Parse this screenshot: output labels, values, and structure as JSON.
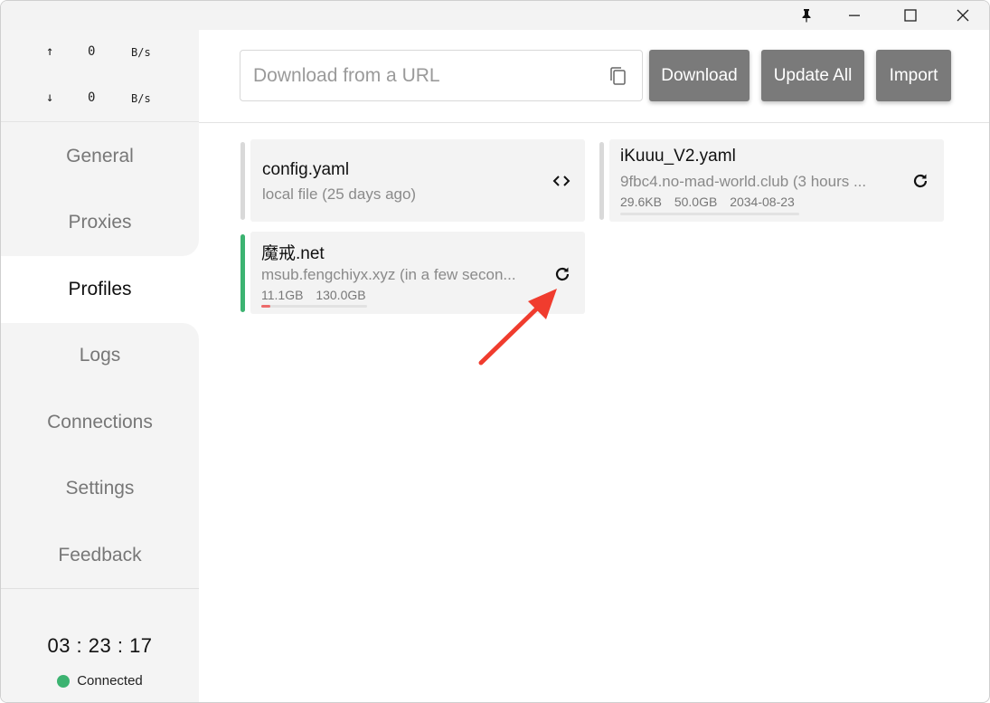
{
  "titlebar": {
    "pin_icon": "pin-icon",
    "minimize_icon": "minimize-icon",
    "maximize_icon": "maximize-icon",
    "close_icon": "close-icon"
  },
  "traffic": {
    "upload": {
      "arrow": "↑",
      "value": "0",
      "unit": "B/s"
    },
    "download": {
      "arrow": "↓",
      "value": "0",
      "unit": "B/s"
    }
  },
  "nav": {
    "items": [
      {
        "label": "General"
      },
      {
        "label": "Proxies"
      },
      {
        "label": "Profiles"
      },
      {
        "label": "Logs"
      },
      {
        "label": "Connections"
      },
      {
        "label": "Settings"
      },
      {
        "label": "Feedback"
      }
    ],
    "active": "Profiles"
  },
  "status": {
    "clock": "03 : 23 : 17",
    "connection": "Connected",
    "connection_color": "#3cb371"
  },
  "header": {
    "url_placeholder": "Download from a URL",
    "url_value": "",
    "download_label": "Download",
    "update_all_label": "Update All",
    "import_label": "Import"
  },
  "profiles": [
    {
      "name": "config.yaml",
      "subtitle": "local file (25 days ago)",
      "action_icon": "code-icon",
      "selected": false
    },
    {
      "name": "iKuuu_V2.yaml",
      "subtitle": "9fbc4.no-mad-world.club (3 hours ...",
      "used": "29.6KB",
      "total": "50.0GB",
      "expires": "2034-08-23",
      "usage_fraction": 0.0,
      "action_icon": "refresh-icon",
      "selected": false
    },
    {
      "name": "魔戒.net",
      "subtitle": "msub.fengchiyx.xyz (in a few secon...",
      "used": "11.1GB",
      "total": "130.0GB",
      "usage_fraction": 0.085,
      "action_icon": "refresh-icon",
      "selected": true
    }
  ],
  "colors": {
    "accent_active": "#3cb371",
    "button_bg": "#7a7a7a",
    "usage_fill": "#ec6b6b",
    "annotation_arrow": "#f03c2e"
  }
}
